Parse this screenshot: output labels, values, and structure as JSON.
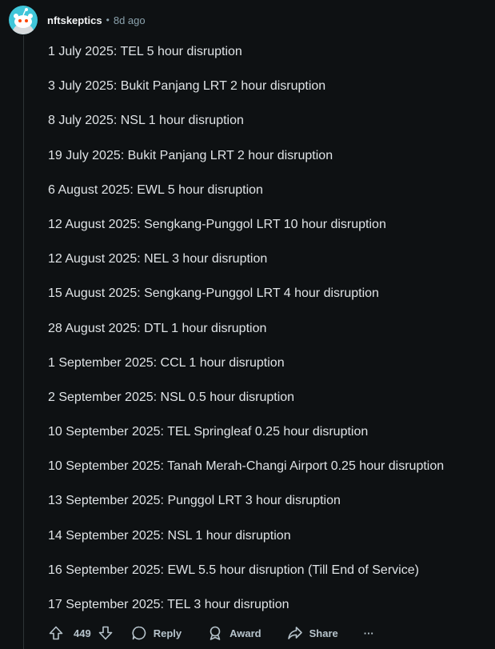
{
  "comment": {
    "author": "nftskeptics",
    "separator": "•",
    "time": "8d ago",
    "lines": [
      "1 July 2025: TEL 5 hour disruption",
      "3 July 2025: Bukit Panjang LRT 2 hour disruption",
      "8 July 2025: NSL 1 hour disruption",
      "19 July 2025: Bukit Panjang LRT 2 hour disruption",
      "6 August 2025: EWL 5 hour disruption",
      "12 August 2025: Sengkang-Punggol LRT 10 hour disruption",
      "12 August 2025: NEL 3 hour disruption",
      "15 August 2025: Sengkang-Punggol LRT 4 hour disruption",
      "28 August 2025: DTL 1 hour disruption",
      "1 September 2025: CCL 1 hour disruption",
      "2 September 2025: NSL 0.5 hour disruption",
      "10 September 2025: TEL Springleaf 0.25 hour disruption",
      "10 September 2025: Tanah Merah-Changi Airport 0.25 hour disruption",
      "13 September 2025: Punggol LRT 3 hour disruption",
      "14 September 2025: NSL 1 hour disruption",
      "16 September 2025: EWL 5.5 hour disruption (Till End of Service)",
      "17 September 2025: TEL 3 hour disruption"
    ]
  },
  "actions": {
    "vote_count": "449",
    "reply_label": "Reply",
    "award_label": "Award",
    "share_label": "Share",
    "more_label": "···"
  },
  "icons": {
    "avatar": "snoo-avatar-icon",
    "upvote": "upvote-arrow-icon",
    "downvote": "downvote-arrow-icon",
    "reply": "speech-bubble-icon",
    "award": "award-ribbon-icon",
    "share": "share-arrow-icon"
  },
  "colors": {
    "background": "#0e1113",
    "text": "#dfe3e6",
    "meta": "#8ba2ad",
    "avatar": "#3fc6d9"
  }
}
